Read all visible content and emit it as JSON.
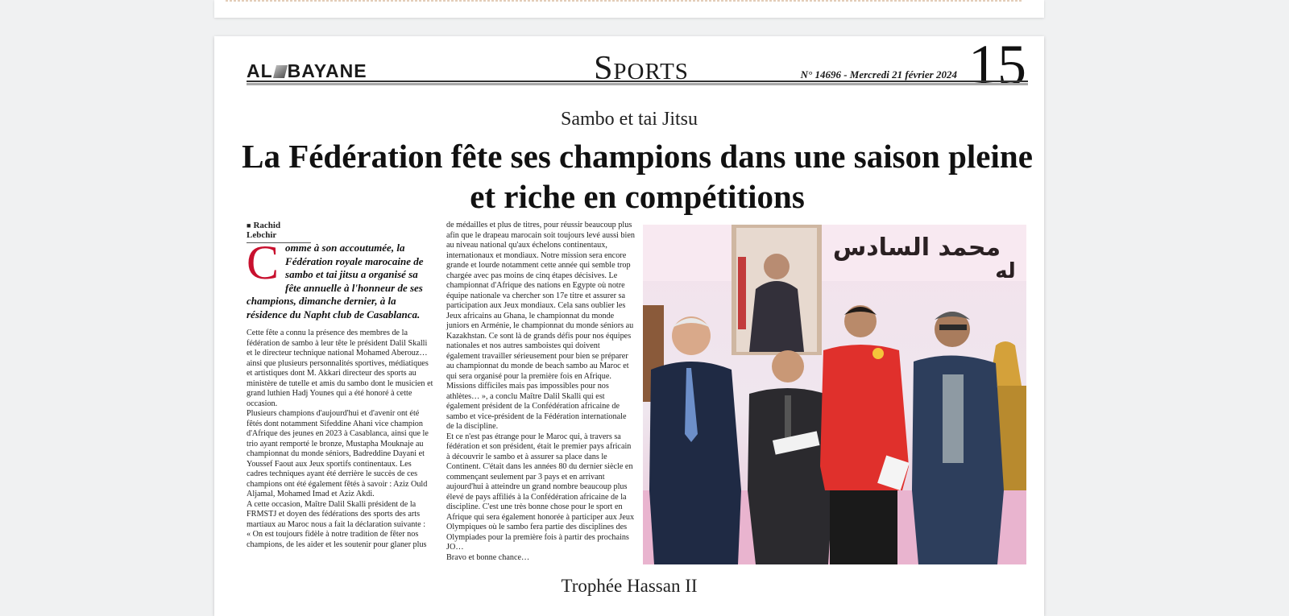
{
  "masthead": {
    "logo": "AL BAYANE",
    "section": "Sports",
    "issue": "N° 14696 - Mercredi 21 février 2024",
    "page_number": "15"
  },
  "article": {
    "kicker": "Sambo et tai Jitsu",
    "headline": "La Fédération fête ses champions dans une saison pleine et riche en compétitions",
    "byline": "Rachid Lebchir",
    "lead_dropcap": "C",
    "lead": "omme à son accoutumée, la Fédération royale marocaine de sambo et tai jitsu a organisé sa fête annuelle à l'honneur de ses champions, dimanche dernier, à la résidence du Napht club de Casablanca.",
    "col1_p1": "Cette fête a connu la présence des membres de la fédération de sambo à leur tête le président Dalil Skalli et le directeur technique national Mohamed Aberouz… ainsi que plusieurs personnalités sportives, médiatiques et artistiques dont M. Akkari directeur des sports au ministère de tutelle et amis du sambo dont le musicien et grand luthien Hadj Younes qui a été honoré à cette occasion.",
    "col1_p2": "Plusieurs champions d'aujourd'hui et d'avenir ont été fêtés dont notamment Sifeddine Ahani vice champion d'Afrique des jeunes en 2023 à Casablanca, ainsi que le trio ayant remporté le bronze, Mustapha Mouknaje au championnat du monde séniors, Badreddine Dayani et Youssef Faout aux Jeux sportifs continentaux. Les cadres techniques ayant été derrière le succès de ces champions ont été également fêtés à savoir : Aziz Ould Aljamal, Mohamed Imad et Aziz Akdi.",
    "col1_p3": "A cette occasion, Maître Dalil Skalli président de la FRMSTJ et doyen des fédérations des sports des arts martiaux au Maroc nous a fait la déclaration suivante :",
    "col1_p4": "« On est toujours fidèle à notre tradition de fêter nos champions, de les aider et les soutenir pour glaner plus",
    "col2_p1": "de médailles et plus de titres, pour réussir beaucoup plus afin que le drapeau marocain soit toujours levé aussi bien au niveau national qu'aux échelons continentaux, internationaux et mondiaux. Notre mission sera encore grande et lourde notamment cette année qui semble trop chargée avec pas moins de cinq étapes décisives. Le championnat d'Afrique des nations en Egypte où notre équipe nationale va chercher son 17e titre et assurer sa participation aux Jeux mondiaux. Cela sans oublier les Jeux africains au Ghana, le championnat du monde juniors en Arménie, le championnat du monde séniors au Kazakhstan. Ce sont là de grands défis pour nos équipes nationales et nos autres samboistes qui doivent également travailler sérieusement pour bien se préparer au championnat du monde de beach sambo au Maroc et qui sera organisé pour la première fois en Afrique. Missions difficiles mais pas impossibles pour nos athlètes… », a conclu Maître Dalil Skalli qui est également président de la Confédération africaine de sambo et vice-président de la Fédération internationale de la discipline.",
    "col2_p2": "Et ce n'est pas étrange pour le Maroc qui, à travers sa fédération et son président, était le premier pays africain à découvrir le sambo et à assurer sa place dans le Continent. C'était dans les années 80 du dernier siècle en commençant seulement par 3 pays et en arrivant aujourd'hui à atteindre un grand nombre beaucoup plus élevé de pays affiliés à la Confédération africaine de la discipline. C'est une très bonne chose pour le sport en Afrique qui sera également honorée à participer aux Jeux Olympiques où le sambo fera partie des disciplines des Olympiades pour la première fois à partir des prochains JO…",
    "col2_p3": "Bravo et bonne chance…",
    "photo_banner_text": "محمد السادس",
    "photo_banner_text2": "له"
  },
  "next_article": {
    "kicker": "Trophée Hassan II"
  },
  "colors": {
    "background": "#f0f1f2",
    "dropcap": "#c8102e",
    "jacket_red": "#e0302c"
  }
}
